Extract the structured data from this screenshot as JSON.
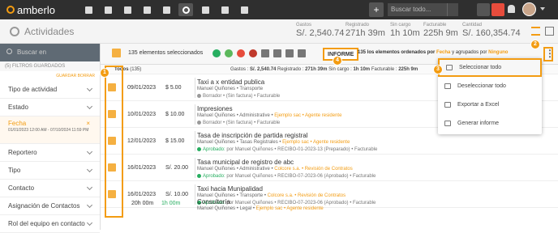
{
  "app": {
    "brand": "amberlo"
  },
  "topbar": {
    "nav_icons": [
      "dashboard-icon",
      "briefcase-icon",
      "document-icon",
      "bank-icon",
      "calendar-icon",
      "activities-icon",
      "folder-icon",
      "file-icon",
      "mail-icon"
    ],
    "search_placeholder": "Buscar todo...",
    "colors": {
      "bg": "#2f2f2f",
      "accent": "#f39c12"
    }
  },
  "header": {
    "title": "Actividades",
    "stats": [
      {
        "label": "Gastos",
        "value": "S/. 2,540.74"
      },
      {
        "label": "Registrado",
        "value": "271h 39m"
      },
      {
        "label": "Sin cargo",
        "value": "1h 10m"
      },
      {
        "label": "Facturable",
        "value": "225h 9m"
      },
      {
        "label": "Cantidad",
        "value": "S/. 160,354.74"
      }
    ]
  },
  "sidebar": {
    "search_placeholder": "Buscar en",
    "saved_filters": "(5) FILTROS GUARDADOS",
    "links": [
      "GUARDAR",
      "BORRAR"
    ],
    "items": [
      {
        "label": "Tipo de actividad"
      },
      {
        "label": "Estado"
      },
      {
        "label": "Fecha",
        "range": "01/01/2023 12:00 AM - 07/10/2024 11:59 PM"
      },
      {
        "label": "Reportero"
      },
      {
        "label": "Tipo"
      },
      {
        "label": "Contacto"
      },
      {
        "label": "Asignación de Contactos"
      },
      {
        "label": "Rol del equipo en contacto"
      }
    ]
  },
  "toolbar": {
    "selected": "135 elementos seleccionados",
    "informe": "INFORME",
    "ordered_prefix": "135 los elementos ordenados por",
    "order_field": "Fecha",
    "group_prefix": "y agrupados por",
    "group_field": "Ninguno"
  },
  "subbar": {
    "all": "Todos",
    "count": "(135)",
    "gastos_label": "Gastos :",
    "gastos": "S/. 2,540.74",
    "reg_label": "Registrado :",
    "reg": "271h 39m",
    "sincargo_label": "Sin cargo :",
    "sincargo": "1h 10m",
    "fact_label": "Facturable :",
    "fact": "225h 9m"
  },
  "rows": [
    {
      "date": "09/01/2023",
      "amount": "$ 5.00",
      "title": "Taxi a x entidad publica",
      "meta": "Manuel Quiñones • Transporte",
      "meta2": "Borrador • (Sin factura) • Facturable"
    },
    {
      "date": "10/01/2023",
      "amount": "$ 10.00",
      "title": "Impresiones",
      "meta": "Manuel Quiñones • Administrative •",
      "meta_or": "Ejemplo sac • Agente residente",
      "meta2": "Borrador • (Sin factura) • Facturable"
    },
    {
      "date": "12/01/2023",
      "amount": "$ 15.00",
      "title": "Tasa de inscripción de partida registral",
      "meta": "Manuel Quiñones • Tasas Registrales •",
      "meta_or": "Ejemplo sac • Agente residente",
      "meta2_green": "Aprobado:",
      "meta2": "por Manuel Quiñones • RECIBO-01-2023-13 (Preparado) • Facturable"
    },
    {
      "date": "16/01/2023",
      "amount": "S/. 20.00",
      "title": "Tasa municipal de registro de abc",
      "meta": "Manuel Quiñones • Administrative •",
      "meta_or": "Colcore s.a. • Revisión de Contratos",
      "meta2_green": "Aprobado:",
      "meta2": "por Manuel Quiñones • RECIBO-07-2023-06 (Aprobado) • Facturable"
    },
    {
      "date": "16/01/2023",
      "amount": "S/. 10.00",
      "title": "Taxi hacia Munipalidad",
      "meta": "Manuel Quiñones • Transporte •",
      "meta_or": "Colcore s.a. • Revisión de Contratos",
      "meta2_green": "Aprobado:",
      "meta2": "por Manuel Quiñones • RECIBO-07-2023-06 (Aprobado) • Facturable"
    }
  ],
  "last_row": {
    "time": "20h 00m",
    "time2": "1h 00m",
    "title": "Consultoría",
    "meta": "Manuel Quiñones • Legal •",
    "meta_or": "Ejemplo sac • Agente residente"
  },
  "menu": {
    "items": [
      {
        "label": "Seleccionar todo",
        "icon": "check-all-icon"
      },
      {
        "label": "Deseleccionar todo",
        "icon": "uncheck-all-icon"
      },
      {
        "label": "Exportar a Excel",
        "icon": "download-icon"
      },
      {
        "label": "Generar informe",
        "icon": "report-icon"
      }
    ]
  },
  "badges": [
    "1",
    "2",
    "3",
    "4"
  ]
}
